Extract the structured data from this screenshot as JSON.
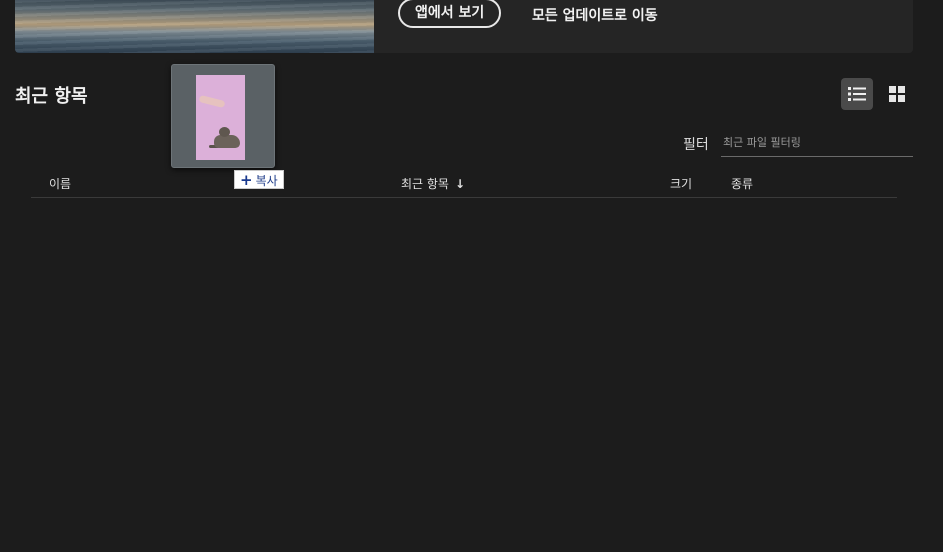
{
  "banner": {
    "open_in_app": "앱에서 보기",
    "go_to_updates": "모든 업데이트로 이동"
  },
  "section": {
    "title": "최근 항목"
  },
  "view_toggle": {
    "list_icon": "list-view-icon",
    "grid_icon": "grid-view-icon",
    "active": "list"
  },
  "filter": {
    "label": "필터",
    "placeholder": "최근 파일 필터링",
    "value": ""
  },
  "table": {
    "columns": {
      "name": "이름",
      "recent": "최근 항목",
      "size": "크기",
      "kind": "종류"
    },
    "sort_arrow": "↓",
    "rows": []
  },
  "drag": {
    "copy_symbol": "+",
    "copy_label": "복사"
  },
  "colors": {
    "background": "#1c1c1c",
    "banner": "#252525",
    "active_toggle": "#4a4a4a",
    "copy_badge_text": "#1f3d8a"
  }
}
